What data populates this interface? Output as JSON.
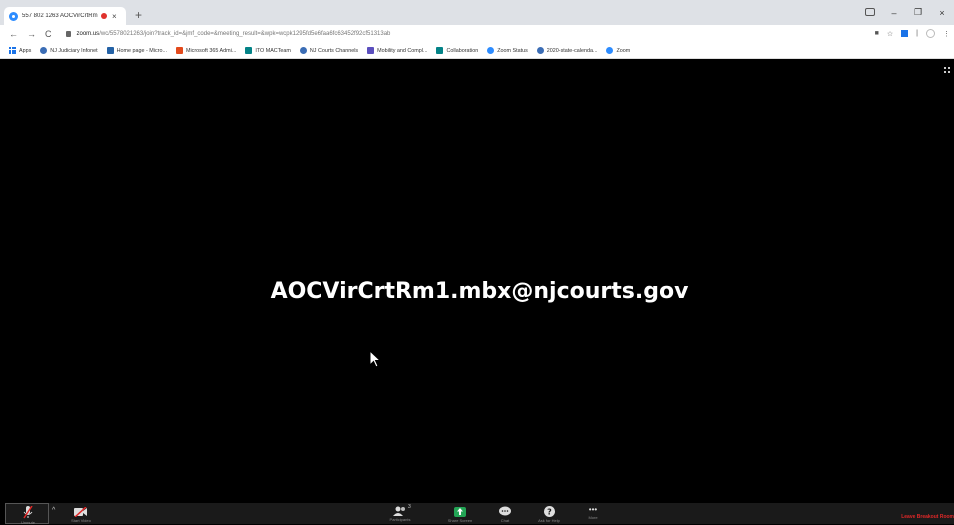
{
  "browser": {
    "tab": {
      "title": "557 802 1263 AOCVirCrtRm",
      "close": "×"
    },
    "new_tab": "+",
    "window_buttons": {
      "minimize": "–",
      "restore": "❐",
      "close": "×"
    },
    "nav": {
      "back": "←",
      "forward": "→",
      "reload": "C"
    },
    "url": {
      "host": "zoom.us",
      "path": "/wc/5578021263/join?track_id=&jmf_code=&meeting_result=&wpk=wcpk1295fd5e6faa6fc63452f92cf51313ab"
    },
    "bookmarks": [
      {
        "label": "Apps",
        "icon": "apps-grid-icon",
        "color": "#1a73e8"
      },
      {
        "label": "NJ Judiciary Infonet",
        "icon": "nj-infonet-icon",
        "color": "#3b6db5"
      },
      {
        "label": "Home page - Micro...",
        "icon": "sharepoint-icon",
        "color": "#2462a6"
      },
      {
        "label": "Microsoft 365 Admi...",
        "icon": "office-icon",
        "color": "#e34a1c"
      },
      {
        "label": "ITO MACTeam",
        "icon": "sharepoint-team-icon",
        "color": "#038387"
      },
      {
        "label": "NJ Courts Channels",
        "icon": "nj-courts-icon",
        "color": "#3b6db5"
      },
      {
        "label": "Mobility and Compl...",
        "icon": "intune-icon",
        "color": "#5b4fbe"
      },
      {
        "label": "Collaboration",
        "icon": "sharepoint-team-icon",
        "color": "#038387"
      },
      {
        "label": "Zoom Status",
        "icon": "zoom-icon",
        "color": "#2d8cff"
      },
      {
        "label": "2020-state-calenda...",
        "icon": "nj-courts-icon",
        "color": "#3b6db5"
      },
      {
        "label": "Zoom",
        "icon": "zoom-icon",
        "color": "#2d8cff"
      }
    ]
  },
  "meeting": {
    "participant_name": "AOCVirCrtRm1.mbx@njcourts.gov"
  },
  "controls": {
    "unmute_label": "Unmute",
    "start_video_label": "Start Video",
    "participants_label": "Participants",
    "participants_count": "3",
    "share_label": "Share Screen",
    "chat_label": "Chat",
    "help_label": "Ask for Help",
    "more_label": "More",
    "more_glyph": "•••",
    "leave_label": "Leave Breakout Room"
  },
  "colors": {
    "meeting_bg": "#000000",
    "control_bar": "#1a1a1a",
    "leave_red": "#e02828",
    "share_green": "#23a455",
    "zoom_blue": "#2d8cff"
  }
}
